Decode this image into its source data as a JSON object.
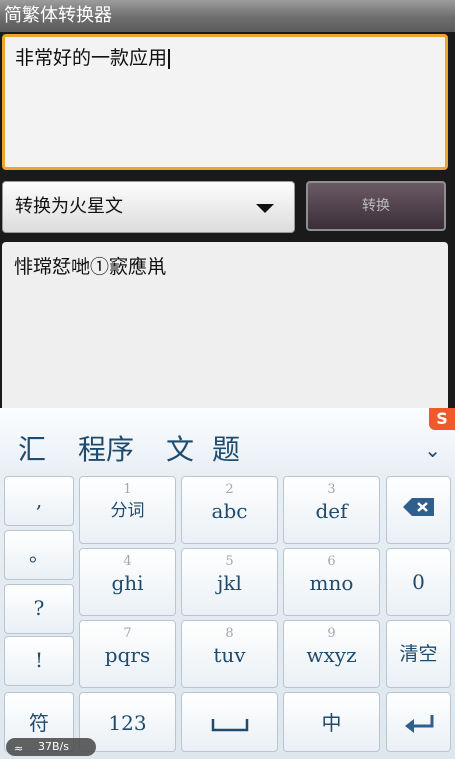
{
  "app": {
    "title": "简繁体转换器"
  },
  "input": {
    "text": "非常好的一款应用"
  },
  "mode": {
    "selected": "转换为火星文"
  },
  "convert": {
    "label": "转换"
  },
  "output": {
    "text": "悱瑺恏哋①窾應鼡"
  },
  "keyboard": {
    "candidates": [
      "汇",
      "程序",
      "文",
      "题"
    ],
    "left_keys": [
      ",",
      "。",
      "?",
      "!"
    ],
    "grid": [
      {
        "num": "1",
        "label": "分词"
      },
      {
        "num": "2",
        "label": "abc"
      },
      {
        "num": "3",
        "label": "def"
      },
      {
        "num": "4",
        "label": "ghi"
      },
      {
        "num": "5",
        "label": "jkl"
      },
      {
        "num": "6",
        "label": "mno"
      },
      {
        "num": "7",
        "label": "pqrs"
      },
      {
        "num": "8",
        "label": "tuv"
      },
      {
        "num": "9",
        "label": "wxyz"
      }
    ],
    "right_keys": {
      "zero": "0",
      "clear": "清空"
    },
    "bottom": {
      "symbols": "符",
      "numeric": "123",
      "chinese": "中"
    },
    "logo": "S"
  },
  "status": {
    "speed": "37B/s"
  },
  "colors": {
    "accent_border": "#f2a233",
    "key_text": "#1e4b6e",
    "logo": "#ef5a28"
  }
}
